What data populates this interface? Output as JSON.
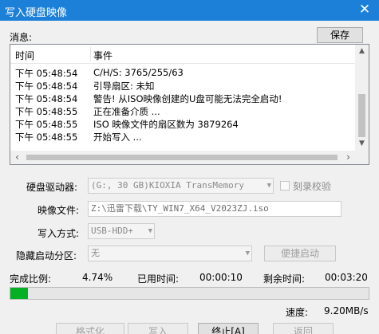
{
  "window": {
    "title": "写入硬盘映像",
    "close_glyph": "✕"
  },
  "messages": {
    "label": "消息:",
    "save_label": "保存",
    "col_time": "时间",
    "col_event": "事件",
    "rows": [
      {
        "time": "下午 05:48:54",
        "event": "C/H/S: 3765/255/63"
      },
      {
        "time": "下午 05:48:54",
        "event": "引导扇区: 未知"
      },
      {
        "time": "下午 05:48:54",
        "event": "警告! 从ISO映像创建的U盘可能无法完全启动!"
      },
      {
        "time": "下午 05:48:55",
        "event": "正在准备介质 ..."
      },
      {
        "time": "下午 05:48:55",
        "event": "ISO 映像文件的扇区数为 3879264"
      },
      {
        "time": "下午 05:48:55",
        "event": "开始写入 ..."
      }
    ]
  },
  "form": {
    "drive_label": "硬盘驱动器:",
    "drive_value": "(G:, 30 GB)KIOXIA  TransMemory",
    "verify_label": "刻录校验",
    "image_label": "映像文件:",
    "image_value": "Z:\\迅雷下载\\TY_WIN7_X64_V2023ZJ.iso",
    "method_label": "写入方式:",
    "method_value": "USB-HDD+",
    "hidden_label": "隐藏启动分区:",
    "hidden_value": "无",
    "portable_label": "便捷启动"
  },
  "progress": {
    "done_label": "完成比例:",
    "done_value": "4.74%",
    "done_fraction": 0.0474,
    "elapsed_label": "已用时间:",
    "elapsed_value": "00:00:10",
    "remaining_label": "剩余时间:",
    "remaining_value": "00:03:20",
    "speed_label": "速度:",
    "speed_value": "9.20MB/s"
  },
  "buttons": {
    "format": "格式化",
    "write": "写入",
    "abort": "终止[A]",
    "back": "返回"
  }
}
